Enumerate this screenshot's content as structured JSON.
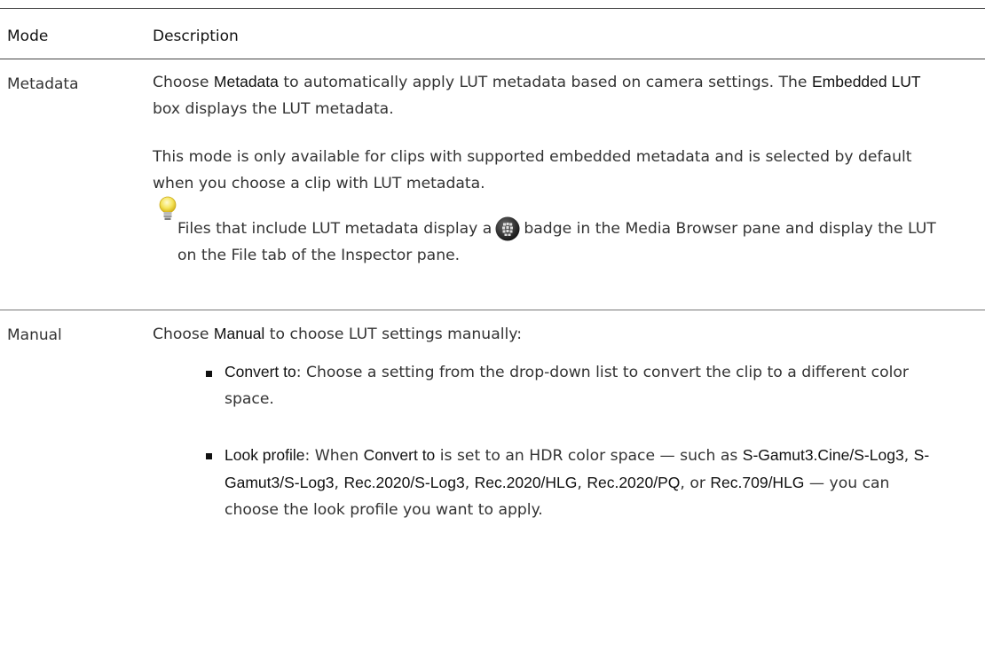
{
  "table": {
    "headers": {
      "mode": "Mode",
      "description": "Description"
    },
    "rows": [
      {
        "mode": "Metadata",
        "p1": {
          "pre": "Choose ",
          "bold1": "Metadata",
          "mid": " to automatically apply LUT metadata based on camera settings. The ",
          "bold2": "Embedded LUT",
          "post": " box displays the LUT metadata."
        },
        "p2": "This mode is only available for clips with supported embedded metadata and is selected by default when you choose a clip with LUT metadata.",
        "tip": {
          "icon": "lightbulb-icon",
          "pre": "Files that include LUT metadata display a",
          "badge_icon": "lut-badge-icon",
          "post": "badge in the Media Browser pane and display the LUT on the File tab of the Inspector pane."
        }
      },
      {
        "mode": "Manual",
        "intro": {
          "pre": "Choose ",
          "bold": "Manual",
          "post": " to choose LUT settings manually:"
        },
        "bullets": [
          {
            "term": "Convert to",
            "text": ": Choose a setting from the drop-down list to convert the clip to a different color space."
          },
          {
            "term": "Look profile",
            "t1": ": When ",
            "b1": "Convert to",
            "t2": " is set to an HDR color space — such as ",
            "b2": "S-Gamut3.Cine/S-Log3",
            "t3": ", ",
            "b3": "S-Gamut3/S-Log3",
            "t4": ", ",
            "b4": "Rec.2020/S-Log3",
            "t5": ", ",
            "b5": "Rec.2020/HLG",
            "t6": ", ",
            "b6": "Rec.2020/PQ",
            "t7": ", or ",
            "b7": "Rec.709/HLG",
            "t8": " — you can choose the look profile you want to apply."
          }
        ]
      }
    ]
  },
  "colors": {
    "rule": "#444444",
    "text": "#333333",
    "bulb": "#f5e45a"
  }
}
